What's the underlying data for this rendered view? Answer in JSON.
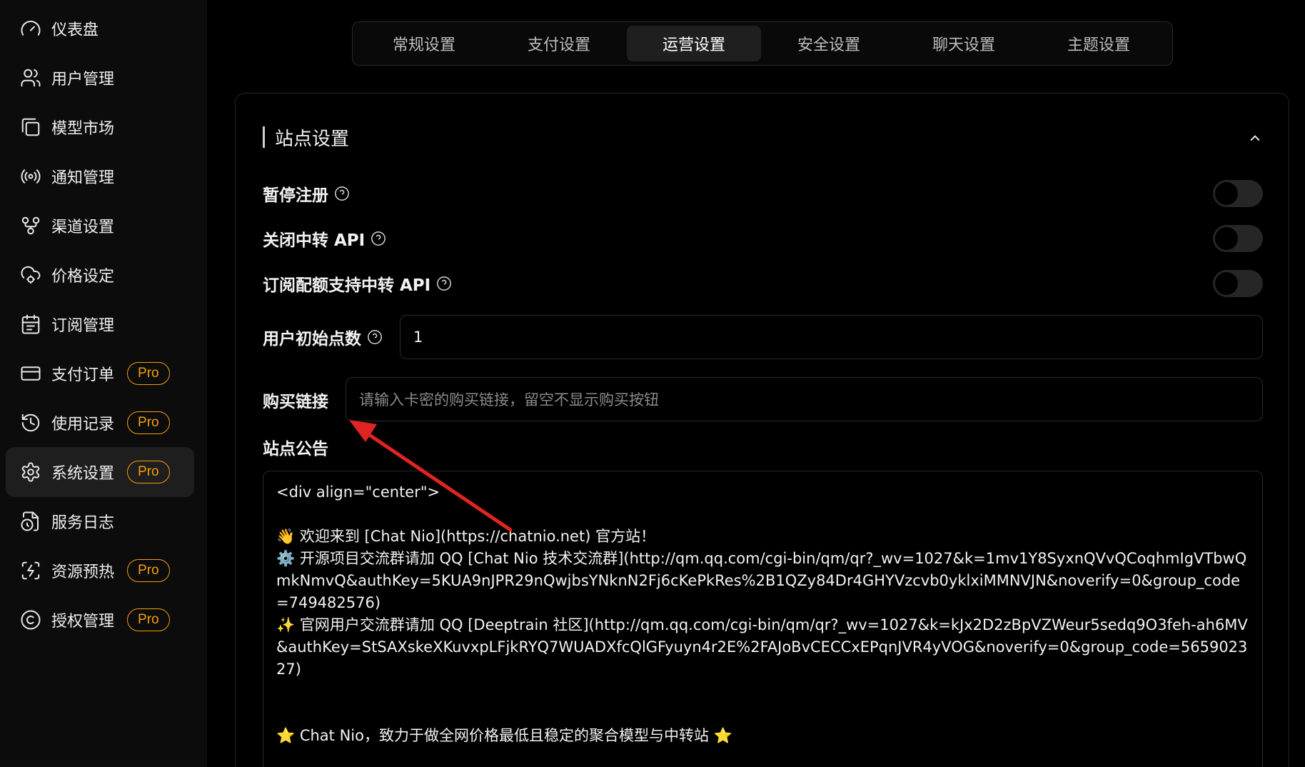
{
  "sidebar": {
    "items": [
      {
        "label": "仪表盘",
        "icon": "gauge-icon",
        "pro": false,
        "active": false
      },
      {
        "label": "用户管理",
        "icon": "users-icon",
        "pro": false,
        "active": false
      },
      {
        "label": "模型市场",
        "icon": "gallery-icon",
        "pro": false,
        "active": false
      },
      {
        "label": "通知管理",
        "icon": "broadcast-icon",
        "pro": false,
        "active": false
      },
      {
        "label": "渠道设置",
        "icon": "git-fork-icon",
        "pro": false,
        "active": false
      },
      {
        "label": "价格设定",
        "icon": "cloud-cog-icon",
        "pro": false,
        "active": false
      },
      {
        "label": "订阅管理",
        "icon": "calendar-icon",
        "pro": false,
        "active": false
      },
      {
        "label": "支付订单",
        "icon": "credit-card-icon",
        "pro": true,
        "active": false
      },
      {
        "label": "使用记录",
        "icon": "history-icon",
        "pro": true,
        "active": false
      },
      {
        "label": "系统设置",
        "icon": "settings-icon",
        "pro": true,
        "active": true
      },
      {
        "label": "服务日志",
        "icon": "file-clock-icon",
        "pro": false,
        "active": false
      },
      {
        "label": "资源预热",
        "icon": "zap-frame-icon",
        "pro": true,
        "active": false
      },
      {
        "label": "授权管理",
        "icon": "copyright-icon",
        "pro": true,
        "active": false
      }
    ],
    "pro_label": "Pro"
  },
  "tabs": [
    {
      "label": "常规设置",
      "active": false
    },
    {
      "label": "支付设置",
      "active": false
    },
    {
      "label": "运营设置",
      "active": true
    },
    {
      "label": "安全设置",
      "active": false
    },
    {
      "label": "聊天设置",
      "active": false
    },
    {
      "label": "主题设置",
      "active": false
    }
  ],
  "section": {
    "title": "站点设置",
    "pause_register_label": "暂停注册",
    "pause_register_on": false,
    "close_relay_label": "关闭中转 API",
    "close_relay_on": false,
    "sub_quota_relay_label": "订阅配额支持中转 API",
    "sub_quota_relay_on": false,
    "initial_points_label": "用户初始点数",
    "initial_points_value": "1",
    "buy_link_label": "购买链接",
    "buy_link_value": "",
    "buy_link_placeholder": "请输入卡密的购买链接，留空不显示购买按钮",
    "announcement_label": "站点公告",
    "announcement_value": "<div align=\"center\">\n\n👋 欢迎来到 [Chat Nio](https://chatnio.net) 官方站！\n⚙️ 开源项目交流群请加 QQ [Chat Nio 技术交流群](http://qm.qq.com/cgi-bin/qm/qr?_wv=1027&k=1mv1Y8SyxnQVvQCoqhmIgVTbwQmkNmvQ&authKey=5KUA9nJPR29nQwjbsYNknN2Fj6cKePkRes%2B1QZy84Dr4GHYVzcvb0yklxiMMNVJN&noverify=0&group_code=749482576)\n✨ 官网用户交流群请加 QQ [Deeptrain 社区](http://qm.qq.com/cgi-bin/qm/qr?_wv=1027&k=kJx2D2zBpVZWeur5sedq9O3feh-ah6MV&authKey=StSAXskeXKuvxpLFjkRYQ7WUADXfcQlGFyuyn4r2E%2FAJoBvCECCxEPqnJVR4yVOG&noverify=0&group_code=565902327)\n\n\n⭐ Chat Nio，致力于做全网价格最低且稳定的聚合模型与中转站 ⭐"
  },
  "colors": {
    "pro_accent": "#f59e0b",
    "annotation_arrow": "#e02424"
  }
}
